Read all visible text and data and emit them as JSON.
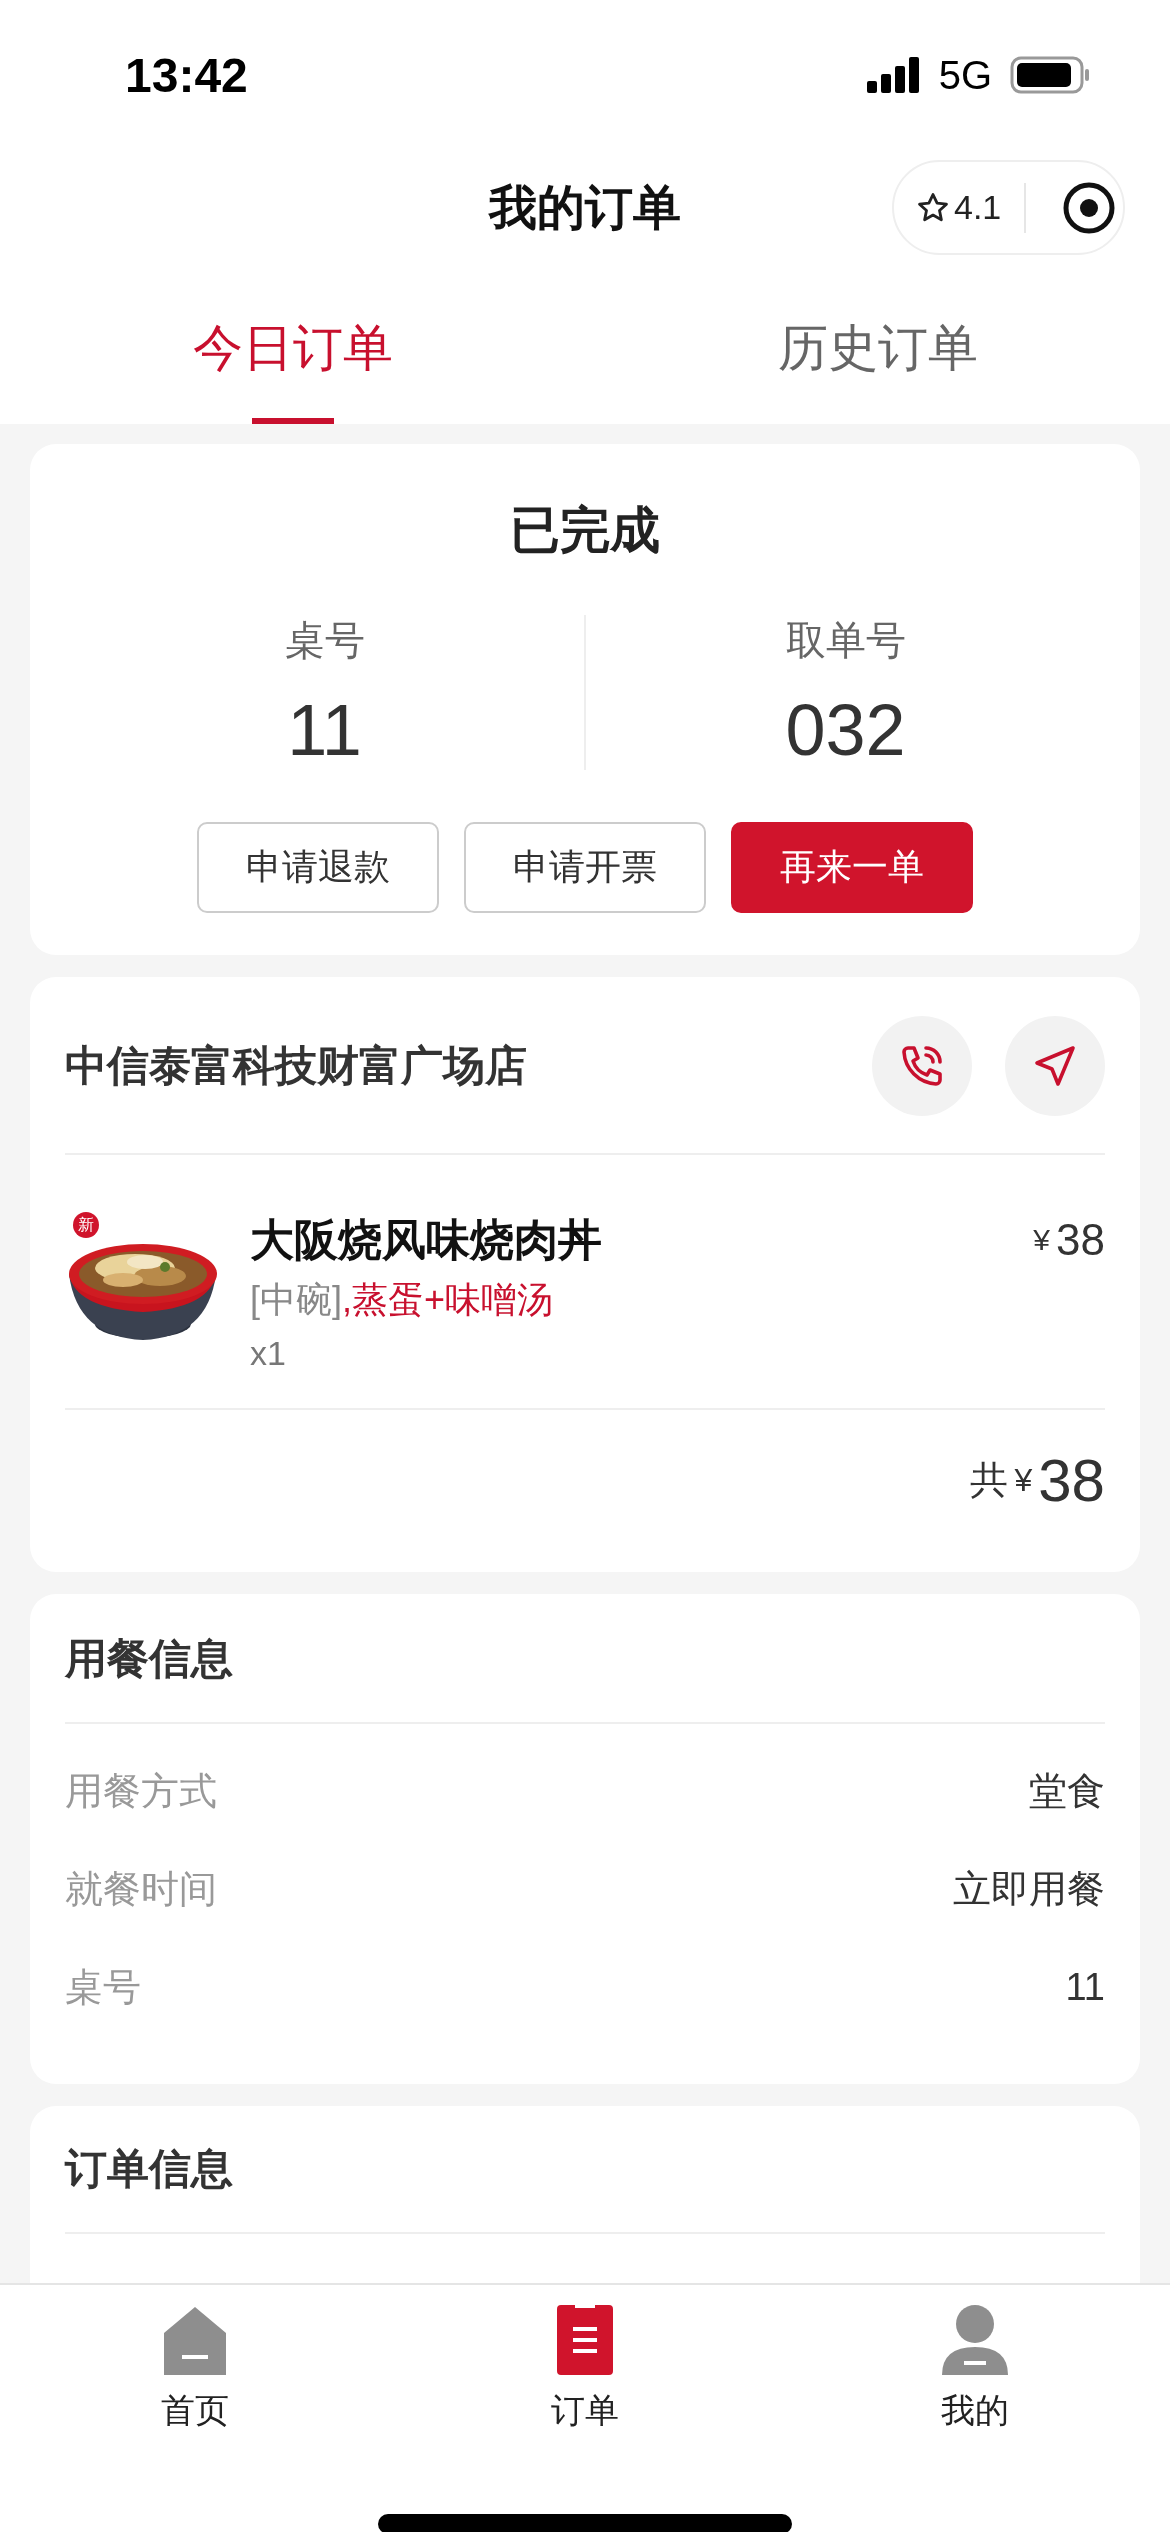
{
  "status_bar": {
    "time": "13:42",
    "network": "5G"
  },
  "nav": {
    "title": "我的订单",
    "rating": "4.1"
  },
  "tabs": [
    {
      "label": "今日订单",
      "selected": true
    },
    {
      "label": "历史订单",
      "selected": false
    }
  ],
  "order_status": {
    "title": "已完成",
    "fields": [
      {
        "label": "桌号",
        "value": "11"
      },
      {
        "label": "取单号",
        "value": "032"
      }
    ],
    "buttons": [
      {
        "label": "申请退款",
        "kind": "outline"
      },
      {
        "label": "申请开票",
        "kind": "outline"
      },
      {
        "label": "再来一单",
        "kind": "primary"
      }
    ]
  },
  "store": {
    "name": "中信泰富科技财富广场店",
    "items": [
      {
        "name": "大阪烧风味烧肉丼",
        "badge": "新",
        "size": "[中碗]",
        "options": ",蒸蛋+味噌汤",
        "quantity": "x1",
        "currency": "¥",
        "price": "38"
      }
    ],
    "total_label": "共",
    "total_currency": "¥",
    "total": "38"
  },
  "dining_info": {
    "title": "用餐信息",
    "rows": [
      {
        "label": "用餐方式",
        "value": "堂食"
      },
      {
        "label": "就餐时间",
        "value": "立即用餐"
      },
      {
        "label": "桌号",
        "value": "11"
      }
    ]
  },
  "order_info": {
    "title": "订单信息"
  },
  "tab_bar": [
    {
      "label": "首页",
      "selected": false
    },
    {
      "label": "订单",
      "selected": true
    },
    {
      "label": "我的",
      "selected": false
    }
  ]
}
